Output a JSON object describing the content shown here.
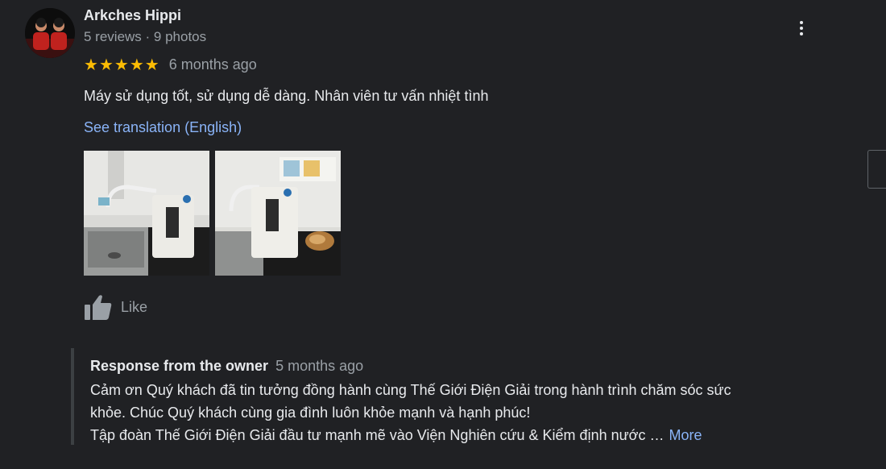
{
  "reviewer": {
    "name": "Arkches Hippi",
    "meta": "5 reviews · 9 photos"
  },
  "rating": {
    "stars": 5,
    "time": "6 months ago"
  },
  "review": {
    "text": "Máy sử dụng tốt, sử dụng dễ dàng. Nhân viên tư vấn nhiệt tình",
    "translate_label": "See translation (English)"
  },
  "actions": {
    "like_label": "Like"
  },
  "owner_response": {
    "title": "Response from the owner",
    "time": "5 months ago",
    "line1": "Cảm ơn Quý khách đã tin tưởng đồng hành cùng Thế Giới Điện Giải trong hành trình chăm sóc sức",
    "line2": "khỏe. Chúc Quý khách cùng gia đình luôn khỏe mạnh và hạnh phúc!",
    "line3": "Tập đoàn Thế Giới Điện Giải đầu tư mạnh mẽ vào Viện Nghiên cứu & Kiểm định nước …",
    "more_label": "More"
  },
  "colors": {
    "background": "#202124",
    "star": "#fbbc04",
    "link": "#8ab4f8",
    "secondary_text": "#9aa0a6"
  },
  "icons": {
    "menu": "more-vertical-icon",
    "like": "thumbs-up-icon"
  }
}
